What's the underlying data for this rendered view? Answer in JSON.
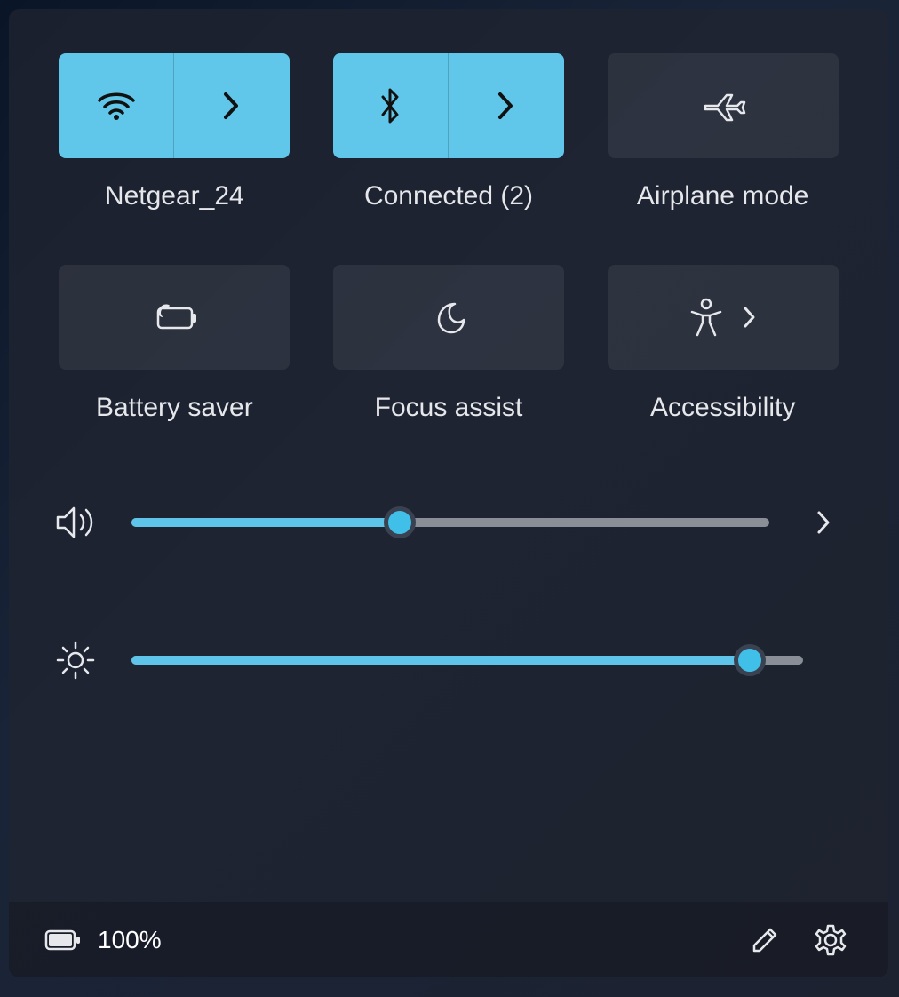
{
  "colors": {
    "accent": "#61c7ea",
    "tile_inactive": "rgba(255,255,255,0.07)"
  },
  "tiles": {
    "wifi": {
      "label": "Netgear_24",
      "active": true,
      "has_expand": true
    },
    "bluetooth": {
      "label": "Connected (2)",
      "active": true,
      "has_expand": true
    },
    "airplane": {
      "label": "Airplane mode",
      "active": false,
      "has_expand": false
    },
    "battery_saver": {
      "label": "Battery saver",
      "active": false,
      "has_expand": false
    },
    "focus_assist": {
      "label": "Focus assist",
      "active": false,
      "has_expand": false
    },
    "accessibility": {
      "label": "Accessibility",
      "active": false,
      "has_expand": true
    }
  },
  "sliders": {
    "volume": {
      "value_percent": 42
    },
    "brightness": {
      "value_percent": 92
    }
  },
  "footer": {
    "battery_percent": "100%"
  }
}
